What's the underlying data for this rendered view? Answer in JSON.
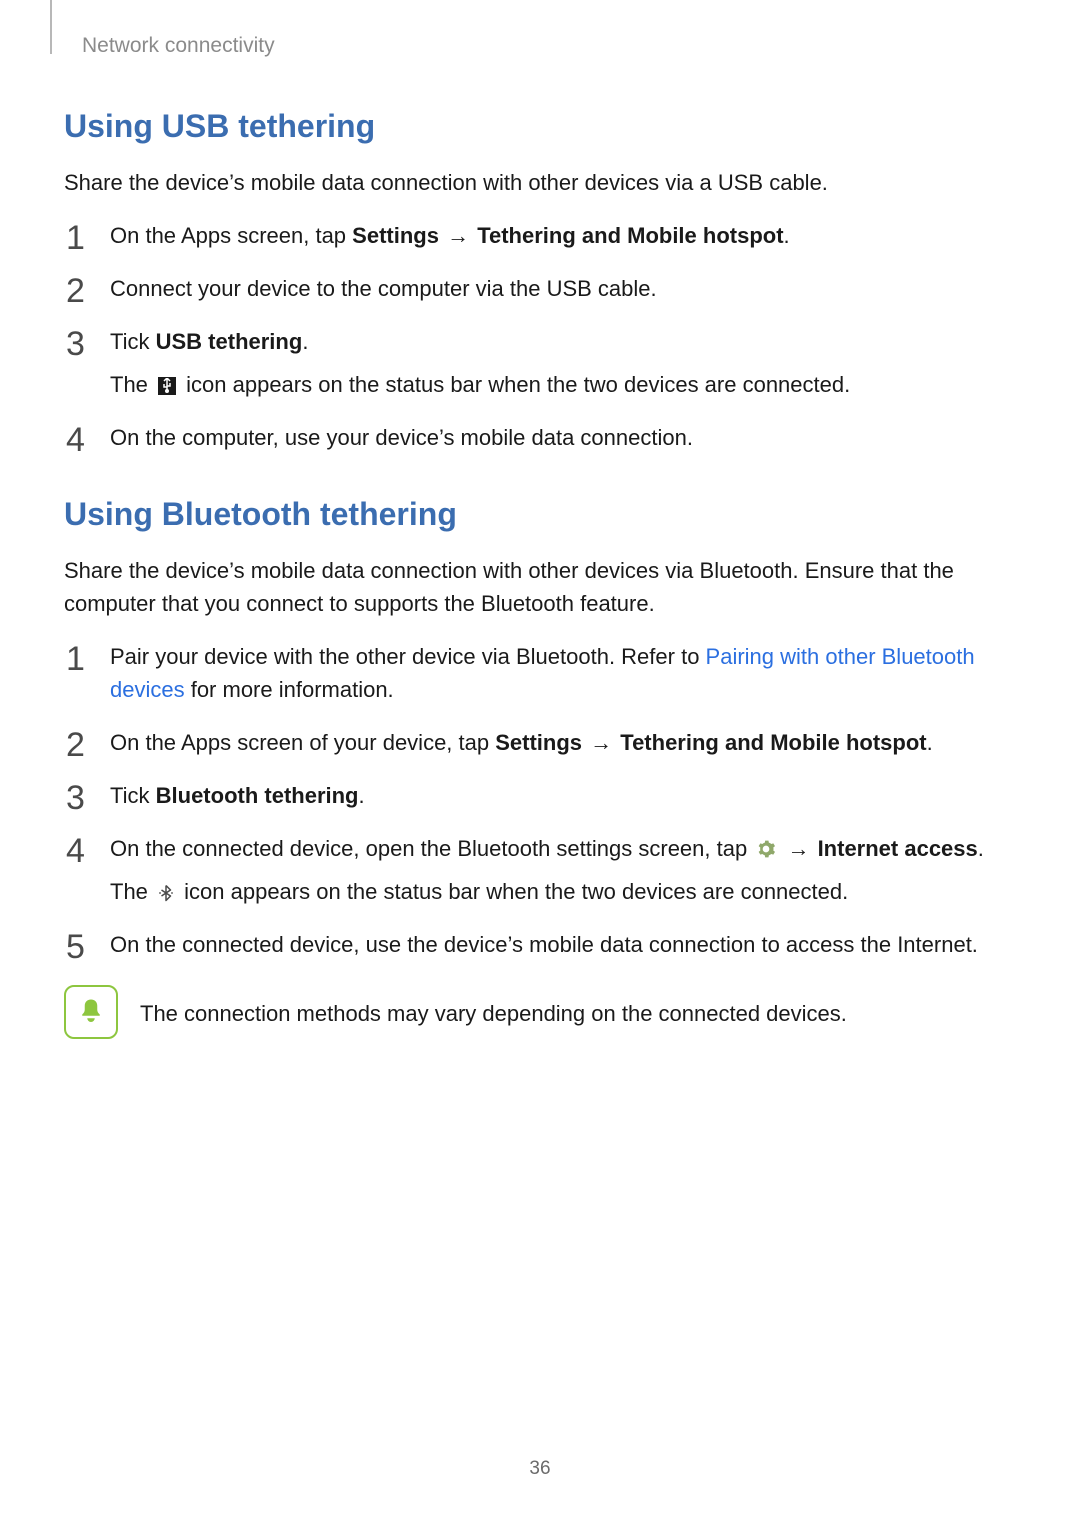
{
  "breadcrumb": "Network connectivity",
  "page_number": "36",
  "section1": {
    "title": "Using USB tethering",
    "intro": "Share the device’s mobile data connection with other devices via a USB cable.",
    "step1_pre": "On the Apps screen, tap ",
    "step1_b1": "Settings",
    "arrow": " → ",
    "step1_b2": "Tethering and Mobile hotspot",
    "step1_post": ".",
    "step2": "Connect your device to the computer via the USB cable.",
    "step3_pre": "Tick ",
    "step3_b": "USB tethering",
    "step3_post": ".",
    "step3_sub_pre": "The ",
    "step3_sub_post": " icon appears on the status bar when the two devices are connected.",
    "step4": "On the computer, use your device’s mobile data connection."
  },
  "section2": {
    "title": "Using Bluetooth tethering",
    "intro": "Share the device’s mobile data connection with other devices via Bluetooth. Ensure that the computer that you connect to supports the Bluetooth feature.",
    "step1_pre": "Pair your device with the other device via Bluetooth. Refer to ",
    "step1_link": "Pairing with other Bluetooth devices",
    "step1_post": " for more information.",
    "step2_pre": "On the Apps screen of your device, tap ",
    "step2_b1": "Settings",
    "arrow": " → ",
    "step2_b2": "Tethering and Mobile hotspot",
    "step2_post": ".",
    "step3_pre": "Tick ",
    "step3_b": "Bluetooth tethering",
    "step3_post": ".",
    "step4_pre": "On the connected device, open the Bluetooth settings screen, tap ",
    "step4_b": "Internet access",
    "step4_post": ".",
    "step4_sub_pre": "The ",
    "step4_sub_post": " icon appears on the status bar when the two devices are connected.",
    "step5": "On the connected device, use the device’s mobile data connection to access the Internet.",
    "note": "The connection methods may vary depending on the connected devices."
  }
}
